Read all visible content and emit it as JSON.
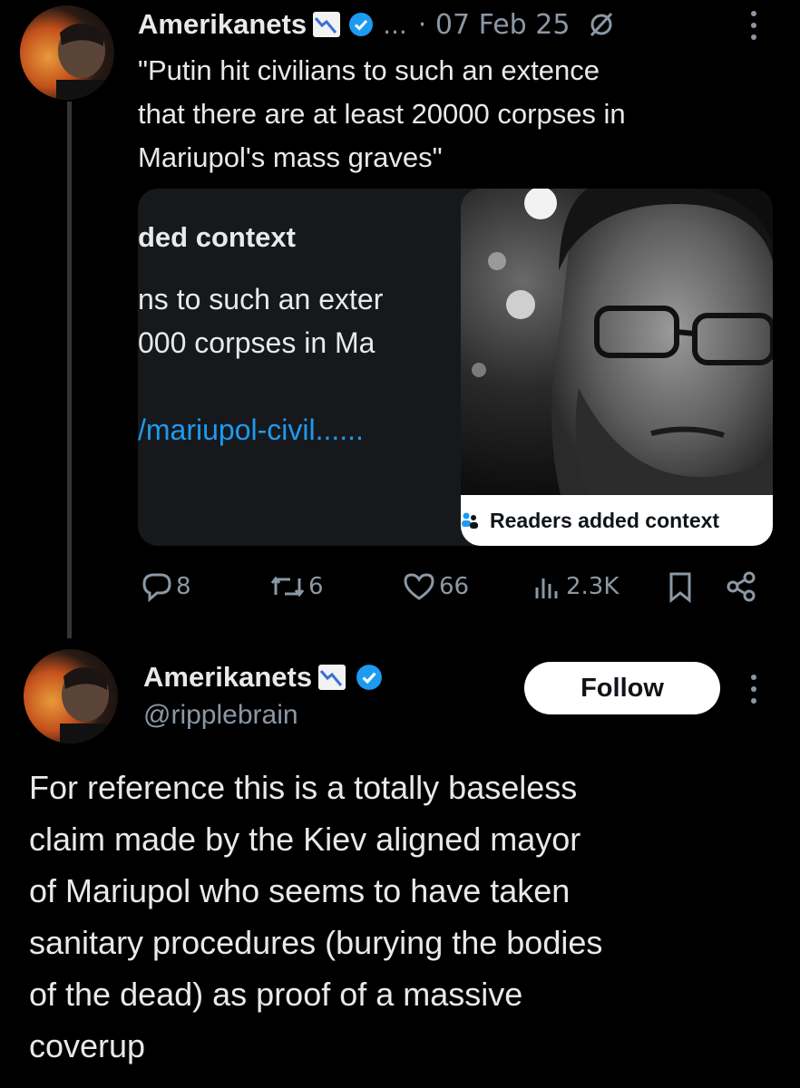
{
  "tweet1": {
    "author_name": "Amerikanets",
    "author_emoji": "chart-decreasing-emoji",
    "more_dots": "...",
    "date": "· 07 Feb 25",
    "text_lines": [
      "\"Putin hit civilians to such an extence",
      "that there are at least 20000 corpses in",
      "Mariupol's mass graves\""
    ],
    "card": {
      "title": "ded context",
      "body_lines": [
        "ns to such an exter",
        "000 corpses in Ma"
      ],
      "link": "/mariupol-civil......"
    },
    "photo_badge": "Readers added context",
    "stats": {
      "replies": "8",
      "reposts": "6",
      "likes": "66",
      "views": "2.3K"
    }
  },
  "tweet2": {
    "author_name": "Amerikanets",
    "handle": "@ripplebrain",
    "follow_label": "Follow",
    "text_lines": [
      "For reference this is a totally baseless",
      "claim made by the Kiev aligned mayor",
      "of Mariupol who seems to have taken",
      "sanitary procedures (burying the bodies",
      "of the dead) as proof of a massive",
      "coverup"
    ]
  },
  "colors": {
    "background": "#000000",
    "text": "#e7e9ea",
    "muted": "#71767b",
    "link": "#1d9bf0",
    "verified": "#1d9bf0"
  }
}
